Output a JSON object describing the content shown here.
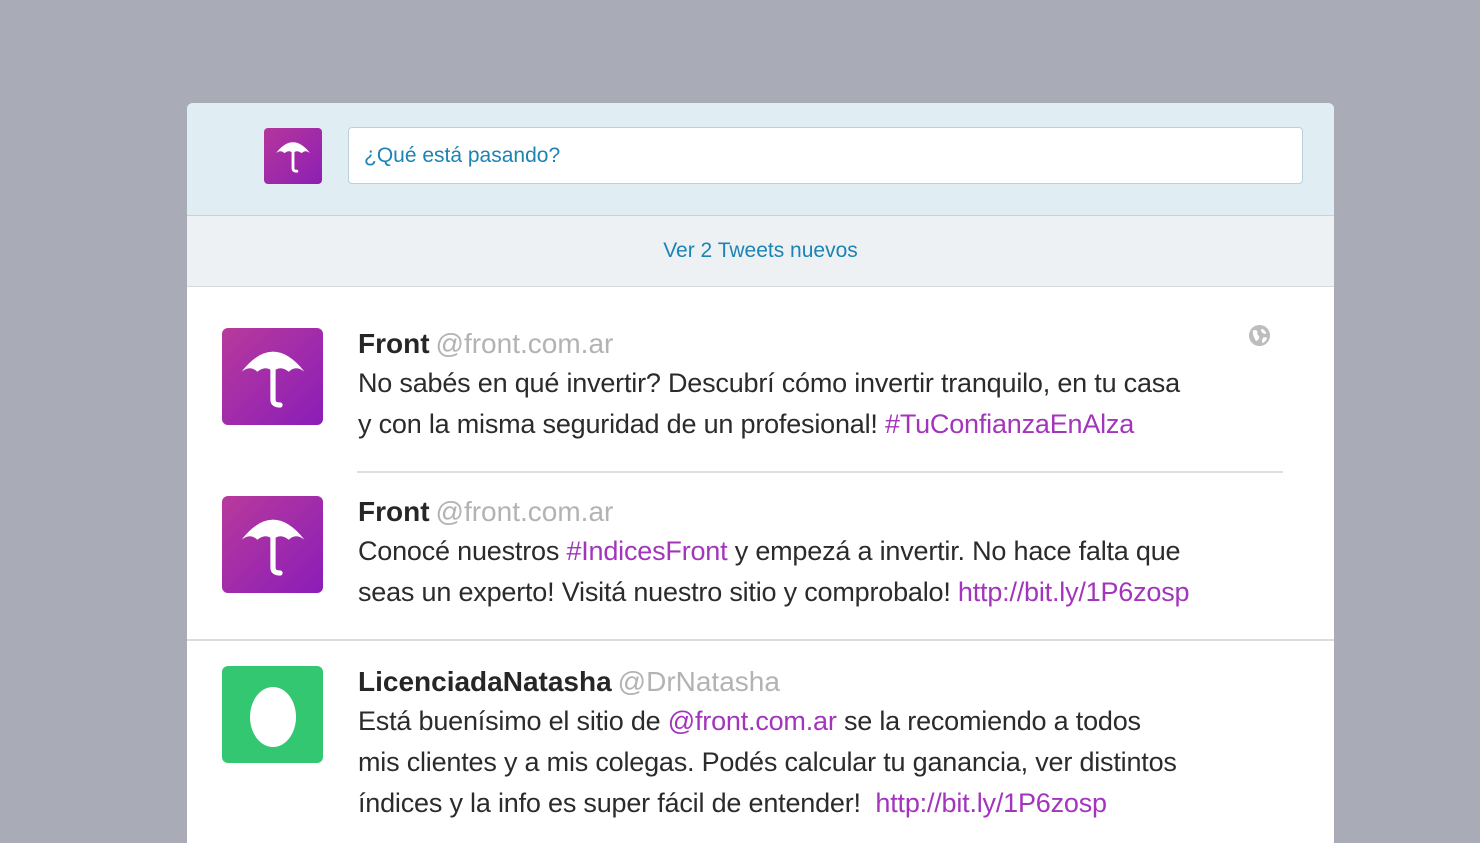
{
  "compose": {
    "placeholder": "¿Qué está pasando?"
  },
  "new_tweets_label": "Ver 2 Tweets nuevos",
  "tweets": [
    {
      "name": "Front",
      "handle": "@front.com.ar",
      "text_parts": [
        {
          "t": "No sabés en qué invertir? Descubrí cómo invertir tranquilo, en tu casa"
        },
        {
          "t": "y con la misma seguridad de un profesional! "
        },
        {
          "t": "#TuConfianzaEnAlza",
          "link": true
        }
      ]
    },
    {
      "name": "Front",
      "handle": "@front.com.ar",
      "text_parts": [
        {
          "t": "Conocé nuestros "
        },
        {
          "t": "#IndicesFront",
          "link": true
        },
        {
          "t": " y empezá a invertir. No hace falta que"
        },
        {
          "t": "seas un experto! Visitá nuestro sitio y comprobalo! "
        },
        {
          "t": "http://bit.ly/1P6zosp",
          "link": true
        }
      ]
    },
    {
      "name": "LicenciadaNatasha",
      "handle": "@DrNatasha",
      "text_parts": [
        {
          "t": "Está buenísimo el sitio de "
        },
        {
          "t": "@front.com.ar",
          "link": true
        },
        {
          "t": " se la recomiendo a todos"
        },
        {
          "t": "mis clientes y a mis colegas. Podés calcular tu ganancia, ver distintos"
        },
        {
          "t": "índices y la info es super fácil de entender!  "
        },
        {
          "t": "http://bit.ly/1P6zosp",
          "link": true
        }
      ]
    }
  ],
  "colors": {
    "background": "#a9acb7",
    "link": "#1b84b3",
    "hashtag": "#a335bd",
    "front_brand": "#9a28b0",
    "natasha_avatar": "#33c771"
  },
  "icons": [
    "umbrella-icon",
    "globe-icon",
    "egg-avatar-icon"
  ]
}
